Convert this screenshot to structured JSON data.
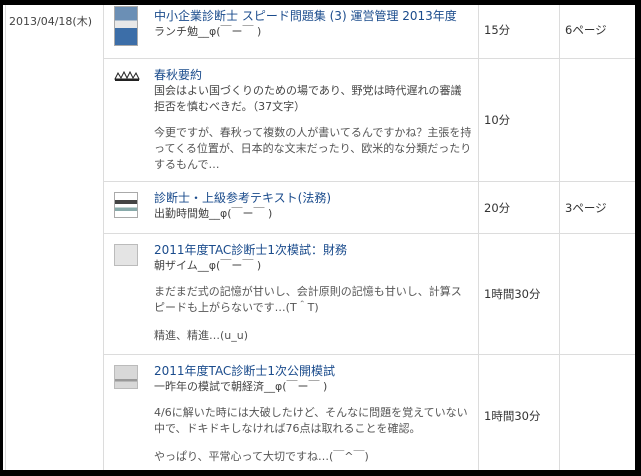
{
  "date": "2013/04/18(木)",
  "rows": [
    {
      "title": "中小企業診断士 スピード問題集 (3) 運営管理 2013年度",
      "sub": "ランチ勉__φ(￣ー￣ )",
      "body": "",
      "body2": "",
      "time": "15分",
      "pages": "6ページ"
    },
    {
      "title": "春秋要約",
      "sub": "国会はよい国づくりのための場であり、野党は時代遅れの審議拒否を慎むべきだ。（37文字）",
      "body": "今更ですが、春秋って複数の人が書いてるんですかね？主張を持ってくる位置が、日本的な文末だったり、欧米的な分類だったりするもんで…",
      "body2": "",
      "time": "10分",
      "pages": ""
    },
    {
      "title": "診断士・上級参考テキスト(法務)",
      "sub": "出勤時間勉__φ(￣ー￣ )",
      "body": "",
      "body2": "",
      "time": "20分",
      "pages": "3ページ"
    },
    {
      "title": "2011年度TAC診断士1次模試：財務",
      "sub": "朝ザイム__φ(￣ー￣ )",
      "body": "まだまだ式の記憶が甘いし、会計原則の記憶も甘いし、計算スピードも上がらないです…(T＾T)",
      "body2": "精進、精進…(u_u)",
      "time": "1時間30分",
      "pages": ""
    },
    {
      "title": "2011年度TAC診断士1次公開模試",
      "sub": "一昨年の模試で朝経済__φ(￣ー￣ )",
      "body": "4/6に解いた時には大破したけど、そんなに問題を覚えていない中で、ドキドキしなければ76点は取れることを確認。",
      "body2": "やっぱり、平常心って大切ですね…(￣^￣)",
      "time": "1時間30分",
      "pages": ""
    }
  ]
}
